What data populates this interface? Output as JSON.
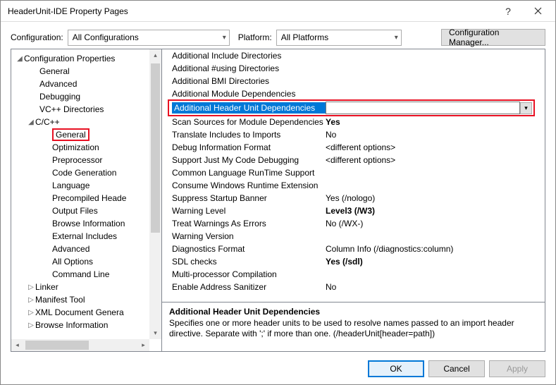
{
  "window": {
    "title": "HeaderUnit-IDE Property Pages"
  },
  "toprow": {
    "configuration_label": "Configuration:",
    "configuration_value": "All Configurations",
    "platform_label": "Platform:",
    "platform_value": "All Platforms",
    "cfgmgr_label": "Configuration Manager..."
  },
  "tree": {
    "root": "Configuration Properties",
    "items_l1a": [
      "General",
      "Advanced",
      "Debugging",
      "VC++ Directories"
    ],
    "ccpp": "C/C++",
    "ccpp_children": [
      "General",
      "Optimization",
      "Preprocessor",
      "Code Generation",
      "Language",
      "Precompiled Heade",
      "Output Files",
      "Browse Information",
      "External Includes",
      "Advanced",
      "All Options",
      "Command Line"
    ],
    "linker": "Linker",
    "manifest": "Manifest Tool",
    "xmldoc": "XML Document Genera",
    "browse": "Browse Information"
  },
  "grid": {
    "rows": [
      {
        "name": "Additional Include Directories",
        "value": ""
      },
      {
        "name": "Additional #using Directories",
        "value": ""
      },
      {
        "name": "Additional BMI Directories",
        "value": ""
      },
      {
        "name": "Additional Module Dependencies",
        "value": ""
      },
      {
        "name": "Additional Header Unit Dependencies",
        "value": "",
        "selected": true
      },
      {
        "name": "Scan Sources for Module Dependencies",
        "value": "Yes",
        "bold": true
      },
      {
        "name": "Translate Includes to Imports",
        "value": "No"
      },
      {
        "name": "Debug Information Format",
        "value": "<different options>"
      },
      {
        "name": "Support Just My Code Debugging",
        "value": "<different options>"
      },
      {
        "name": "Common Language RunTime Support",
        "value": ""
      },
      {
        "name": "Consume Windows Runtime Extension",
        "value": ""
      },
      {
        "name": "Suppress Startup Banner",
        "value": "Yes (/nologo)"
      },
      {
        "name": "Warning Level",
        "value": "Level3 (/W3)",
        "bold": true
      },
      {
        "name": "Treat Warnings As Errors",
        "value": "No (/WX-)"
      },
      {
        "name": "Warning Version",
        "value": ""
      },
      {
        "name": "Diagnostics Format",
        "value": "Column Info (/diagnostics:column)"
      },
      {
        "name": "SDL checks",
        "value": "Yes (/sdl)",
        "bold": true
      },
      {
        "name": "Multi-processor Compilation",
        "value": ""
      },
      {
        "name": "Enable Address Sanitizer",
        "value": "No"
      }
    ]
  },
  "desc": {
    "title": "Additional Header Unit Dependencies",
    "body": "Specifies one or more header units to be used to resolve names passed to an import header directive. Separate with ';' if more than one.  (/headerUnit[header=path])"
  },
  "footer": {
    "ok": "OK",
    "cancel": "Cancel",
    "apply": "Apply"
  }
}
